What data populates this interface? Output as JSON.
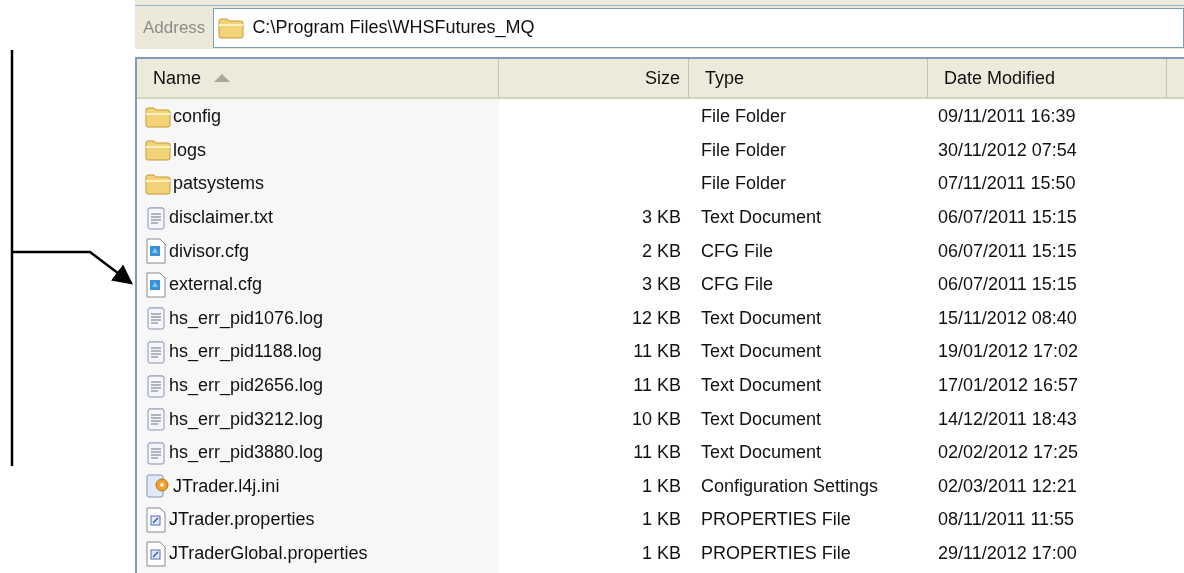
{
  "address_bar": {
    "label": "Address",
    "path": "C:\\Program Files\\WHSFutures_MQ"
  },
  "columns": [
    {
      "label": "Name",
      "sorted": true
    },
    {
      "label": "Size",
      "sorted": false
    },
    {
      "label": "Type",
      "sorted": false
    },
    {
      "label": "Date Modified",
      "sorted": false
    }
  ],
  "rows": [
    {
      "kind": "folder",
      "name": "config",
      "type": "File Folder",
      "date": "09/11/2011 16:39"
    },
    {
      "kind": "folder",
      "name": "logs",
      "type": "File Folder",
      "date": "30/11/2012 07:54"
    },
    {
      "kind": "folder",
      "name": "patsystems",
      "type": "File Folder",
      "date": "07/11/2011 15:50"
    },
    {
      "kind": "text",
      "name": "disclaimer.txt",
      "size": "3 KB",
      "type": "Text Document",
      "date": "06/07/2011 15:15"
    },
    {
      "kind": "cfg",
      "name": "divisor.cfg",
      "size": "2 KB",
      "type": "CFG File",
      "date": "06/07/2011 15:15"
    },
    {
      "kind": "cfg",
      "name": "external.cfg",
      "size": "3 KB",
      "type": "CFG File",
      "date": "06/07/2011 15:15"
    },
    {
      "kind": "text",
      "name": "hs_err_pid1076.log",
      "size": "12 KB",
      "type": "Text Document",
      "date": "15/11/2012 08:40"
    },
    {
      "kind": "text",
      "name": "hs_err_pid1188.log",
      "size": "11 KB",
      "type": "Text Document",
      "date": "19/01/2012 17:02"
    },
    {
      "kind": "text",
      "name": "hs_err_pid2656.log",
      "size": "11 KB",
      "type": "Text Document",
      "date": "17/01/2012 16:57"
    },
    {
      "kind": "text",
      "name": "hs_err_pid3212.log",
      "size": "10 KB",
      "type": "Text Document",
      "date": "14/12/2011 18:43"
    },
    {
      "kind": "text",
      "name": "hs_err_pid3880.log",
      "size": "11 KB",
      "type": "Text Document",
      "date": "02/02/2012 17:25"
    },
    {
      "kind": "ini",
      "name": "JTrader.l4j.ini",
      "size": "1 KB",
      "type": "Configuration Settings",
      "date": "02/03/2011 12:21"
    },
    {
      "kind": "properties",
      "name": "JTrader.properties",
      "size": "1 KB",
      "type": "PROPERTIES File",
      "date": "08/11/2011 11:55"
    },
    {
      "kind": "properties",
      "name": "JTraderGlobal.properties",
      "size": "1 KB",
      "type": "PROPERTIES File",
      "date": "29/11/2012 17:00"
    }
  ]
}
